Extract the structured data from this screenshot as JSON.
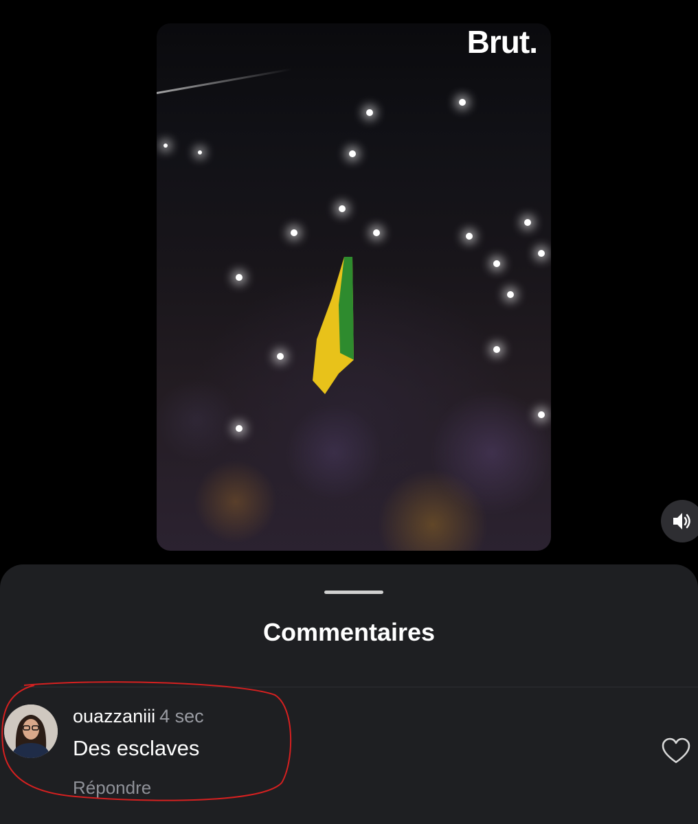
{
  "video": {
    "brand_label": "Brut."
  },
  "controls": {
    "sound_icon": "speaker-icon"
  },
  "comments_sheet": {
    "title": "Commentaires",
    "comments": [
      {
        "username": "ouazzaniii",
        "time": "4 sec",
        "text": "Des esclaves",
        "reply_label": "Répondre",
        "like_icon": "heart-icon"
      }
    ]
  },
  "colors": {
    "sheet_background": "#1e1f22",
    "annotation": "#d62020",
    "flag_green": "#2e8b2e",
    "flag_yellow": "#e8c21a"
  }
}
